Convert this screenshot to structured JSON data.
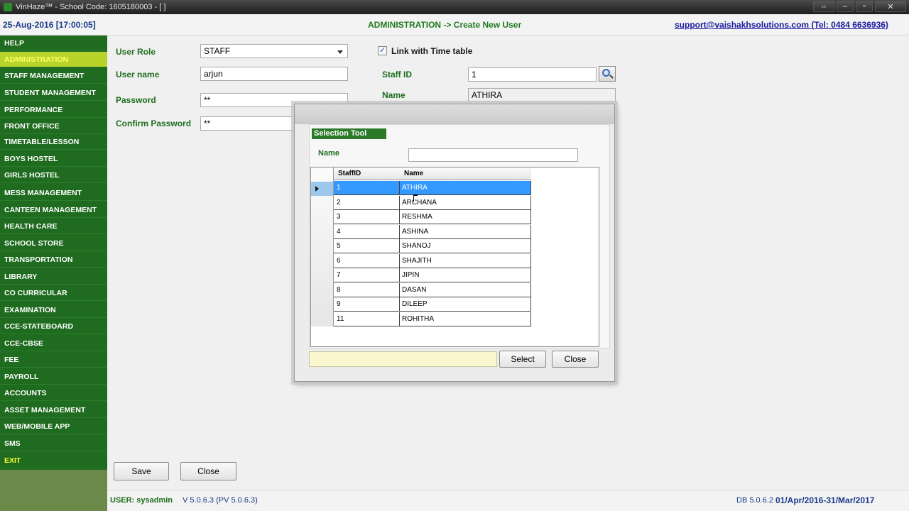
{
  "window": {
    "title": "VinHaze™ -  School Code: 1605180003 - [   ]",
    "minimize_icon": "minimize-icon",
    "maximize_icon": "maximize-icon",
    "close_icon": "close-icon",
    "resize_icon": "resize-icon"
  },
  "header": {
    "datetime": "25-Aug-2016 [17:00:05]",
    "breadcrumb": "ADMINISTRATION -> Create New User",
    "support": "support@vaishakhsolutions.com (Tel: 0484 6636936)"
  },
  "sidebar": {
    "items": [
      {
        "label": "HELP"
      },
      {
        "label": "ADMINISTRATION",
        "active": true
      },
      {
        "label": "STAFF MANAGEMENT"
      },
      {
        "label": "STUDENT MANAGEMENT"
      },
      {
        "label": "PERFORMANCE"
      },
      {
        "label": "FRONT OFFICE"
      },
      {
        "label": "TIMETABLE/LESSON"
      },
      {
        "label": "BOYS HOSTEL"
      },
      {
        "label": "GIRLS HOSTEL"
      },
      {
        "label": "MESS MANAGEMENT"
      },
      {
        "label": "CANTEEN MANAGEMENT"
      },
      {
        "label": "HEALTH CARE"
      },
      {
        "label": "SCHOOL STORE"
      },
      {
        "label": "TRANSPORTATION"
      },
      {
        "label": "LIBRARY"
      },
      {
        "label": "CO CURRICULAR"
      },
      {
        "label": "EXAMINATION"
      },
      {
        "label": "CCE-STATEBOARD"
      },
      {
        "label": "CCE-CBSE"
      },
      {
        "label": "FEE"
      },
      {
        "label": "PAYROLL"
      },
      {
        "label": "ACCOUNTS"
      },
      {
        "label": "ASSET MANAGEMENT"
      },
      {
        "label": "WEB/MOBILE APP"
      },
      {
        "label": "SMS"
      },
      {
        "label": "EXIT"
      }
    ]
  },
  "form": {
    "user_role_label": "User Role",
    "user_role_value": "STAFF",
    "user_name_label": "User name",
    "user_name_value": "arjun",
    "password_label": "Password",
    "password_value": "**",
    "confirm_password_label": "Confirm Password",
    "confirm_password_value": "**",
    "link_timetable_label": "Link with Time table",
    "link_timetable_checked": true,
    "staff_id_label": "Staff ID",
    "staff_id_value": "1",
    "name_label": "Name",
    "name_value": "ATHIRA",
    "save_label": "Save",
    "close_label": "Close"
  },
  "dialog": {
    "group_title": "Selection Tool",
    "name_label": "Name",
    "name_value": "",
    "columns": [
      "StaffID",
      "Name"
    ],
    "rows": [
      {
        "id": "1",
        "name": "ATHIRA",
        "selected": true
      },
      {
        "id": "2",
        "name": "ARCHANA"
      },
      {
        "id": "3",
        "name": "RESHMA"
      },
      {
        "id": "4",
        "name": "ASHINA"
      },
      {
        "id": "5",
        "name": "SHANOJ"
      },
      {
        "id": "6",
        "name": "SHAJITH"
      },
      {
        "id": "7",
        "name": "JIPIN"
      },
      {
        "id": "8",
        "name": "DASAN"
      },
      {
        "id": "9",
        "name": "DILEEP"
      },
      {
        "id": "11",
        "name": "ROHITHA"
      }
    ],
    "select_label": "Select",
    "close_label": "Close"
  },
  "status": {
    "user": "USER: sysadmin",
    "version": "V 5.0.6.3 (PV 5.0.6.3)",
    "db": "DB 5.0.6.2",
    "fiscal_year": "01/Apr/2016-31/Mar/2017"
  },
  "colors": {
    "sidebar_bg": "#1f6b1f",
    "sidebar_active": "#b8d42a",
    "label_green": "#1e6e1e",
    "selection_blue": "#3399ff"
  }
}
